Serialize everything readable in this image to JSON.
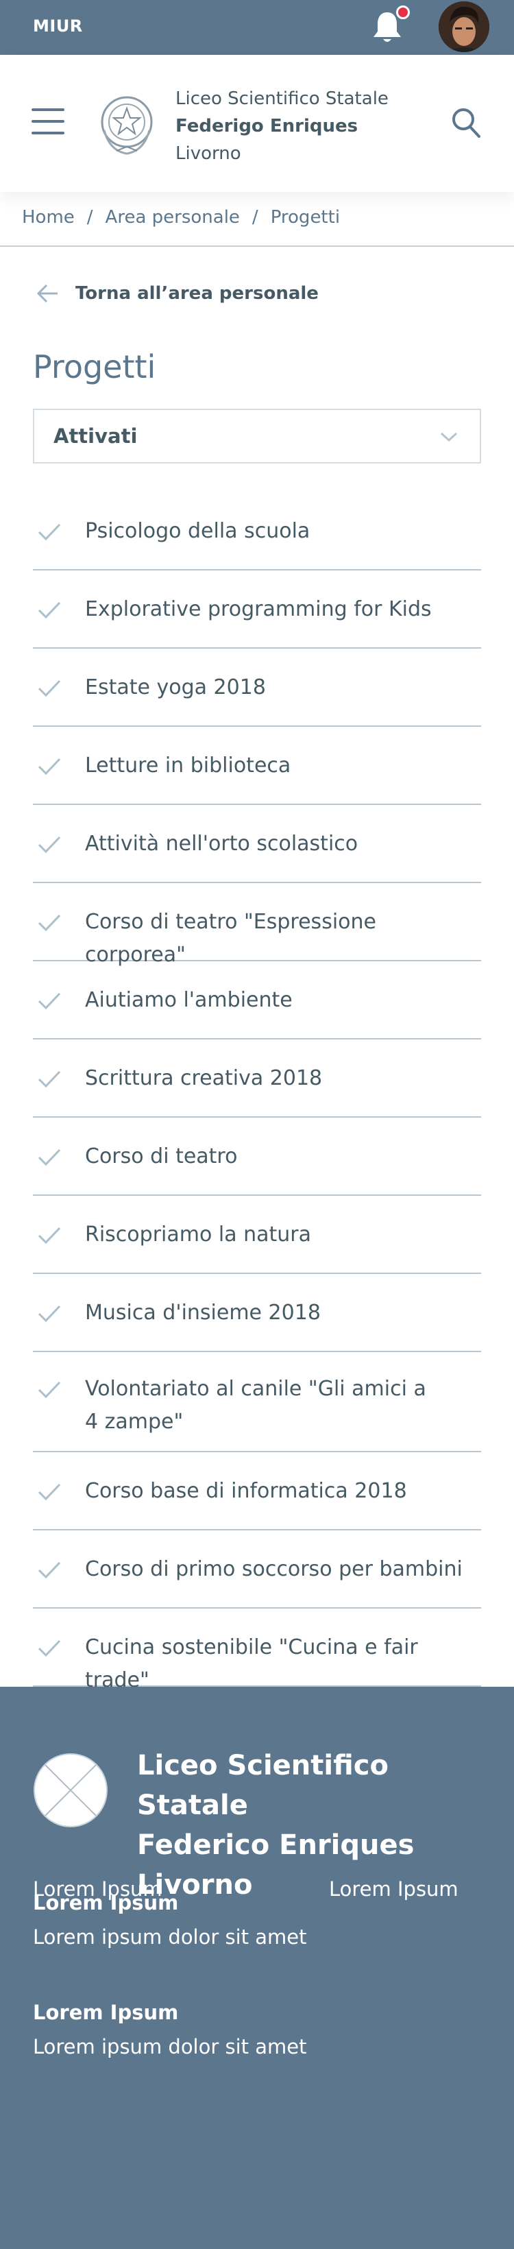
{
  "topbar": {
    "brand": "MIUR",
    "notification_dot_color": "#e5304a"
  },
  "header": {
    "school_line1": "Liceo Scientifico Statale",
    "school_line2": "Federigo Enriques",
    "school_line3": "Livorno"
  },
  "breadcrumb": {
    "items": [
      "Home",
      "Area personale",
      "Progetti"
    ],
    "separator": "/"
  },
  "back_link": "Torna all’area personale",
  "page_title": "Progetti",
  "filter_select": {
    "selected": "Attivati"
  },
  "projects": [
    "Psicologo della scuola",
    "Explorative programming for Kids",
    "Estate yoga 2018",
    "Letture in biblioteca",
    "Attività nell'orto scolastico",
    "Corso di teatro \"Espressione corporea\"",
    "Aiutiamo l'ambiente",
    "Scrittura creativa 2018",
    "Corso di teatro",
    "Riscopriamo la natura",
    "Musica d'insieme 2018",
    "Volontariato al canile \"Gli amici a 4 zampe\"",
    "Corso base di informatica 2018",
    "Corso di primo soccorso per bambini",
    "Cucina sostenibile \"Cucina e fair trade\""
  ],
  "footer": {
    "school_line1": "Liceo Scientifico Statale",
    "school_line2": "Federico Enriques",
    "school_line3": "Livorno",
    "block1_heading": "Lorem Ipsum",
    "block1_text": "Lorem ipsum dolor sit amet",
    "block2_heading": "Lorem Ipsum",
    "block2_text": "Lorem ipsum dolor sit amet",
    "link_left": "Lorem Ipsum",
    "link_right": "Lorem Ipsum"
  },
  "colors": {
    "primary": "#5b768d",
    "text": "#455a64",
    "divider": "#b9c6d0"
  }
}
